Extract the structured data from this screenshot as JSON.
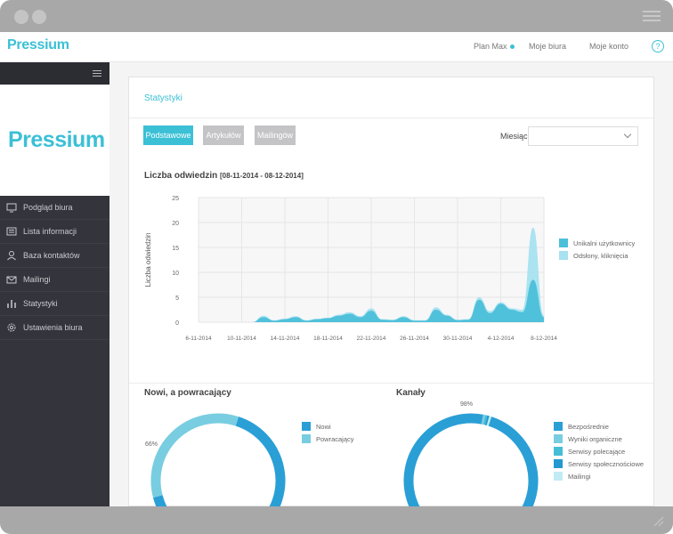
{
  "brand": {
    "logo": "Pressium",
    "accent": "#3bc0d6"
  },
  "topnav": {
    "plan": "Plan Max",
    "offices": "Moje biura",
    "account": "Moje konto",
    "help": "?"
  },
  "sidebar": {
    "items": [
      {
        "label": "Podgląd biura",
        "icon": "monitor-icon"
      },
      {
        "label": "Lista informacji",
        "icon": "list-icon"
      },
      {
        "label": "Baza kontaktów",
        "icon": "user-icon"
      },
      {
        "label": "Mailingi",
        "icon": "envelope-icon"
      },
      {
        "label": "Statystyki",
        "icon": "bar-chart-icon"
      },
      {
        "label": "Ustawienia biura",
        "icon": "gear-icon"
      }
    ]
  },
  "card": {
    "title": "Statystyki",
    "tabs": [
      {
        "label": "Podstawowe",
        "active": true
      },
      {
        "label": "Artykułów",
        "active": false
      },
      {
        "label": "Mailingów",
        "active": false
      }
    ],
    "month_label": "Miesiąc",
    "month_value": ""
  },
  "visits": {
    "title": "Liczba odwiedzin",
    "range": "[08-11-2014 - 08-12-2014]"
  },
  "returning": {
    "title": "Nowi, a powracający"
  },
  "channels": {
    "title": "Kanały"
  },
  "chart_data": [
    {
      "type": "area",
      "title": "Liczba odwiedzin",
      "xlabel": "",
      "ylabel": "Liczba odwiedzin",
      "ylim": [
        0,
        25
      ],
      "yticks": [
        0,
        5,
        10,
        15,
        20,
        25
      ],
      "categories": [
        "6-11-2014",
        "10-11-2014",
        "14-11-2014",
        "18-11-2014",
        "22-11-2014",
        "26-11-2014",
        "30-11-2014",
        "4-12-2014",
        "8-12-2014"
      ],
      "x": [
        8,
        9,
        10,
        11,
        12,
        13,
        14,
        15,
        16,
        17,
        18,
        19,
        20,
        21,
        22,
        23,
        24,
        25,
        26,
        27,
        28,
        29,
        30,
        31,
        32,
        33,
        34,
        35,
        36,
        37,
        38
      ],
      "series": [
        {
          "name": "Unikalni użytkownicy",
          "color": "#4bbfd8",
          "values": [
            0,
            0,
            0,
            0,
            1,
            0.3,
            0.6,
            1,
            0.3,
            0.6,
            0.8,
            1.3,
            1.7,
            1,
            2.3,
            0.5,
            0.4,
            1,
            0.3,
            0.3,
            2.5,
            1.3,
            0.4,
            0.5,
            4.5,
            1.8,
            3.7,
            2.5,
            2,
            8.5,
            1
          ]
        },
        {
          "name": "Odsłony, kliknięcia",
          "color": "#a6e2f0",
          "values": [
            0,
            0,
            0,
            0,
            1.3,
            0.4,
            0.7,
            1.2,
            0.4,
            0.7,
            0.9,
            1.5,
            2,
            1.2,
            2.8,
            0.6,
            0.5,
            1.2,
            0.4,
            0.4,
            3,
            1.5,
            0.5,
            0.6,
            5,
            2.2,
            4,
            2.8,
            2.5,
            19,
            1.3
          ]
        }
      ],
      "grid": true,
      "legend": "right"
    },
    {
      "type": "pie",
      "title": "Nowi, a powracający",
      "slices": [
        {
          "name": "Nowi",
          "value": 66,
          "label": "66%",
          "color": "#2a9fd6"
        },
        {
          "name": "Powracający",
          "value": 34,
          "label": "34%",
          "color": "#79cde0"
        }
      ],
      "legend": "right"
    },
    {
      "type": "pie",
      "title": "Kanały",
      "slices": [
        {
          "name": "Bezpośrednie",
          "value": 98,
          "label": "98%",
          "color": "#2a9fd6"
        },
        {
          "name": "Wyniki organiczne",
          "value": 0.5,
          "color": "#79cde0"
        },
        {
          "name": "Serwisy polecające",
          "value": 0.5,
          "color": "#45bdd6"
        },
        {
          "name": "Serwisy społecznościowe",
          "value": 0.5,
          "color": "#2399cf"
        },
        {
          "name": "Mailingi",
          "value": 0.5,
          "color": "#c2ebf4"
        }
      ],
      "legend": "right"
    }
  ]
}
